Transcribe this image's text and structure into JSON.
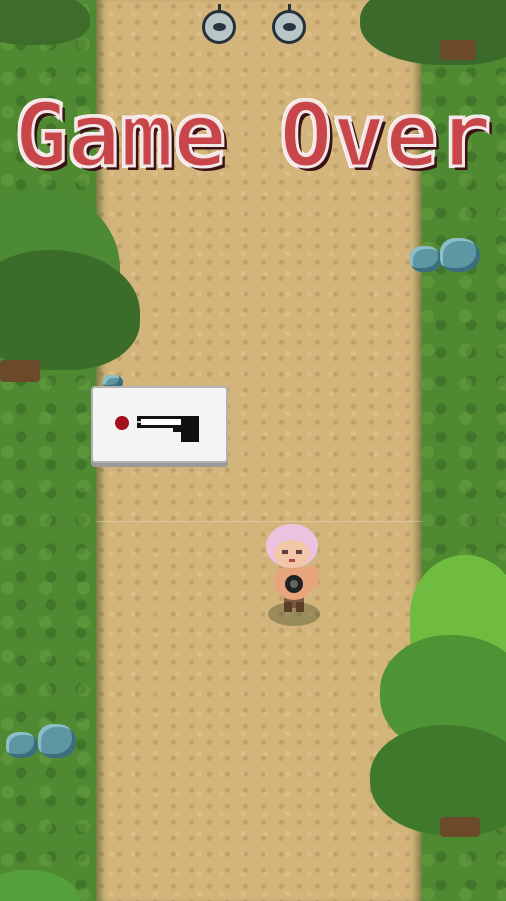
{
  "hud": {
    "enemy_indicators": [
      {
        "icon": "enemy-face-icon"
      },
      {
        "icon": "enemy-face-icon"
      }
    ],
    "title": "Game Over"
  },
  "weapon_card": {
    "icon": "pistol-icon",
    "status_icon": "red-dot-icon"
  },
  "colors": {
    "title_red": "#c8464a",
    "grass": "#4f8a33",
    "path": "#d3b57b",
    "status_dot": "#a3111b"
  }
}
